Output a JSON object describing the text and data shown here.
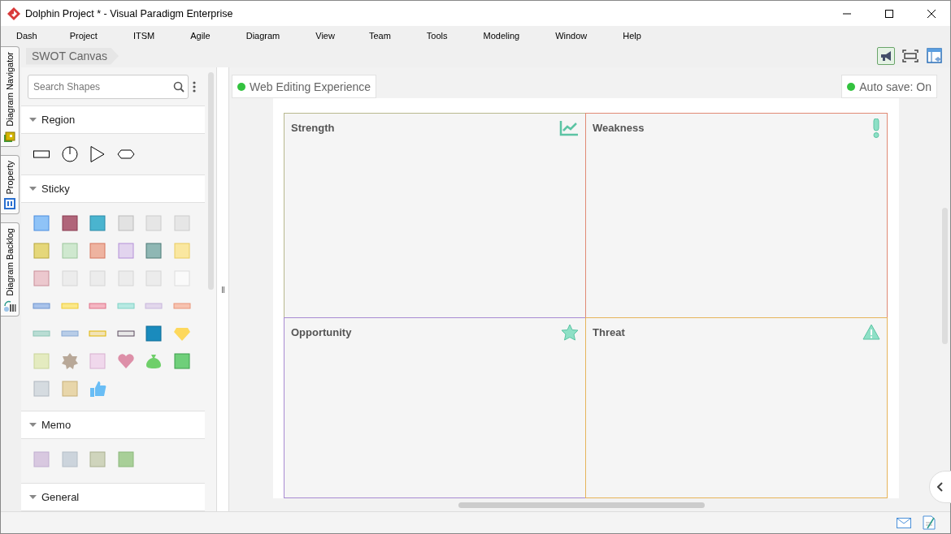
{
  "window": {
    "title": "Dolphin Project * - Visual Paradigm Enterprise"
  },
  "menu": [
    "Dash",
    "Project",
    "ITSM",
    "Agile",
    "Diagram",
    "View",
    "Team",
    "Tools",
    "Modeling",
    "Window",
    "Help"
  ],
  "side_tabs": [
    {
      "label": "Diagram Navigator"
    },
    {
      "label": "Property"
    },
    {
      "label": "Diagram Backlog"
    }
  ],
  "breadcrumb": "SWOT Canvas",
  "shape_search": {
    "placeholder": "Search Shapes"
  },
  "palette": [
    {
      "label": "Region",
      "expanded": true,
      "kind": "region"
    },
    {
      "label": "Sticky",
      "expanded": true,
      "kind": "sticky"
    },
    {
      "label": "Memo",
      "expanded": true,
      "kind": "memo"
    },
    {
      "label": "General",
      "expanded": true,
      "kind": "general"
    }
  ],
  "status_pills": [
    {
      "label": "Web Editing Experience",
      "on": true
    },
    {
      "label": "Auto save: On",
      "on": true
    }
  ],
  "swot": [
    {
      "title": "Strength",
      "color": "#b8b88e",
      "kind": "growth"
    },
    {
      "title": "Weakness",
      "color": "#e08a74",
      "kind": "exclamation"
    },
    {
      "title": "Opportunity",
      "color": "#a88bd2",
      "kind": "star"
    },
    {
      "title": "Threat",
      "color": "#e6b45a",
      "kind": "warning"
    }
  ]
}
